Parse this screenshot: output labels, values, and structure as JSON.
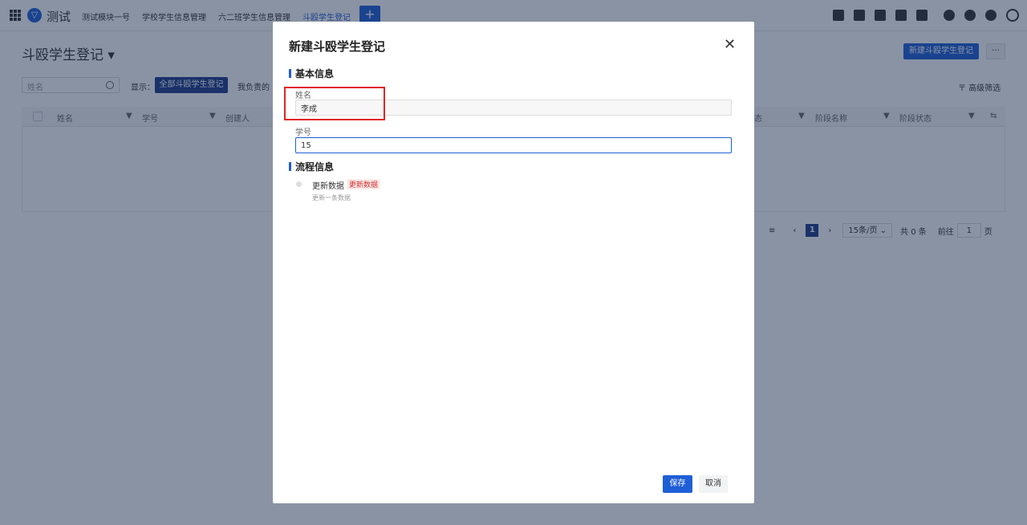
{
  "app": {
    "name": "测试",
    "logo_icon": "brand-logo-icon"
  },
  "nav": {
    "tabs": [
      "测试模块一号",
      "学校学生信息管理",
      "六二班学生信息管理",
      "斗殴学生登记"
    ],
    "active_tab": "斗殴学生登记",
    "add_label": "+"
  },
  "page": {
    "title": "斗殴学生登记 ▾",
    "new_button": "新建斗殴学生登记",
    "more_button": "···",
    "search_placeholder": "姓名",
    "show_label": "显示：",
    "filter_active": "全部斗殴学生登记",
    "filter_other": "我负责的",
    "advanced_filter": "〒 高级筛选",
    "table_columns": [
      "姓名",
      "学号",
      "创建人",
      "态",
      "阶段名称",
      "阶段状态"
    ],
    "pager": {
      "current": "1",
      "page_size": "15条/页",
      "total": "共 0 条",
      "goto_label": "前往",
      "goto_value": "1",
      "page_unit": "页"
    }
  },
  "modal": {
    "title": "新建斗殴学生登记",
    "close_icon": "close-icon",
    "section_basic": "基本信息",
    "name_label": "姓名",
    "name_value": "李成",
    "id_label": "学号",
    "id_value": "15",
    "section_flow": "流程信息",
    "step_title": "更新数据",
    "step_tag": "更新数据",
    "step_desc": "更新一条数据",
    "save_label": "保存",
    "cancel_label": "取消"
  },
  "colors": {
    "primary": "#1f5fd6",
    "highlight": "#e02424",
    "overlay": "rgba(22,40,72,0.5)"
  }
}
